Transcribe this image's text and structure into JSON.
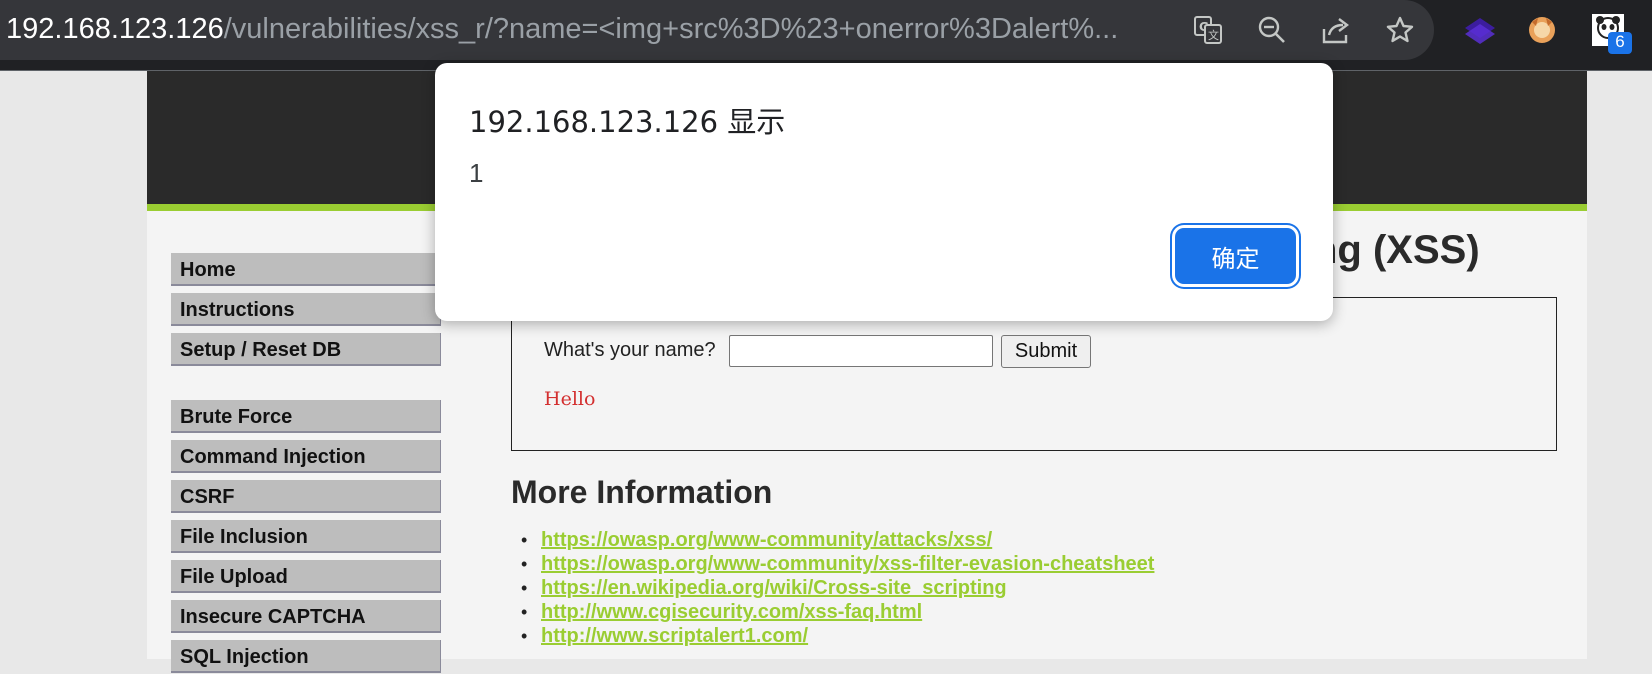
{
  "browser": {
    "url_host": "192.168.123.126",
    "url_path": "/vulnerabilities/xss_r/?name=<img+src%3D%23+onerror%3Dalert%...",
    "extension_badge": "6"
  },
  "menu": {
    "items": [
      "Home",
      "Instructions",
      "Setup / Reset DB",
      "Brute Force",
      "Command Injection",
      "CSRF",
      "File Inclusion",
      "File Upload",
      "Insecure CAPTCHA",
      "SQL Injection"
    ]
  },
  "main": {
    "title_visible": "ng (XSS)",
    "form_label": "What's your name?",
    "input_value": "",
    "submit_label": "Submit",
    "result_text": "Hello",
    "more_info_heading": "More Information",
    "links": [
      "https://owasp.org/www-community/attacks/xss/",
      "https://owasp.org/www-community/xss-filter-evasion-cheatsheet",
      "https://en.wikipedia.org/wiki/Cross-site_scripting",
      "http://www.cgisecurity.com/xss-faq.html",
      "http://www.scriptalert1.com/"
    ]
  },
  "dialog": {
    "title": "192.168.123.126 显示",
    "message": "1",
    "ok_label": "确定"
  },
  "colors": {
    "accent_green": "#9acd32",
    "dialog_button": "#1a73e8",
    "header_dark": "#2a2a2a"
  }
}
